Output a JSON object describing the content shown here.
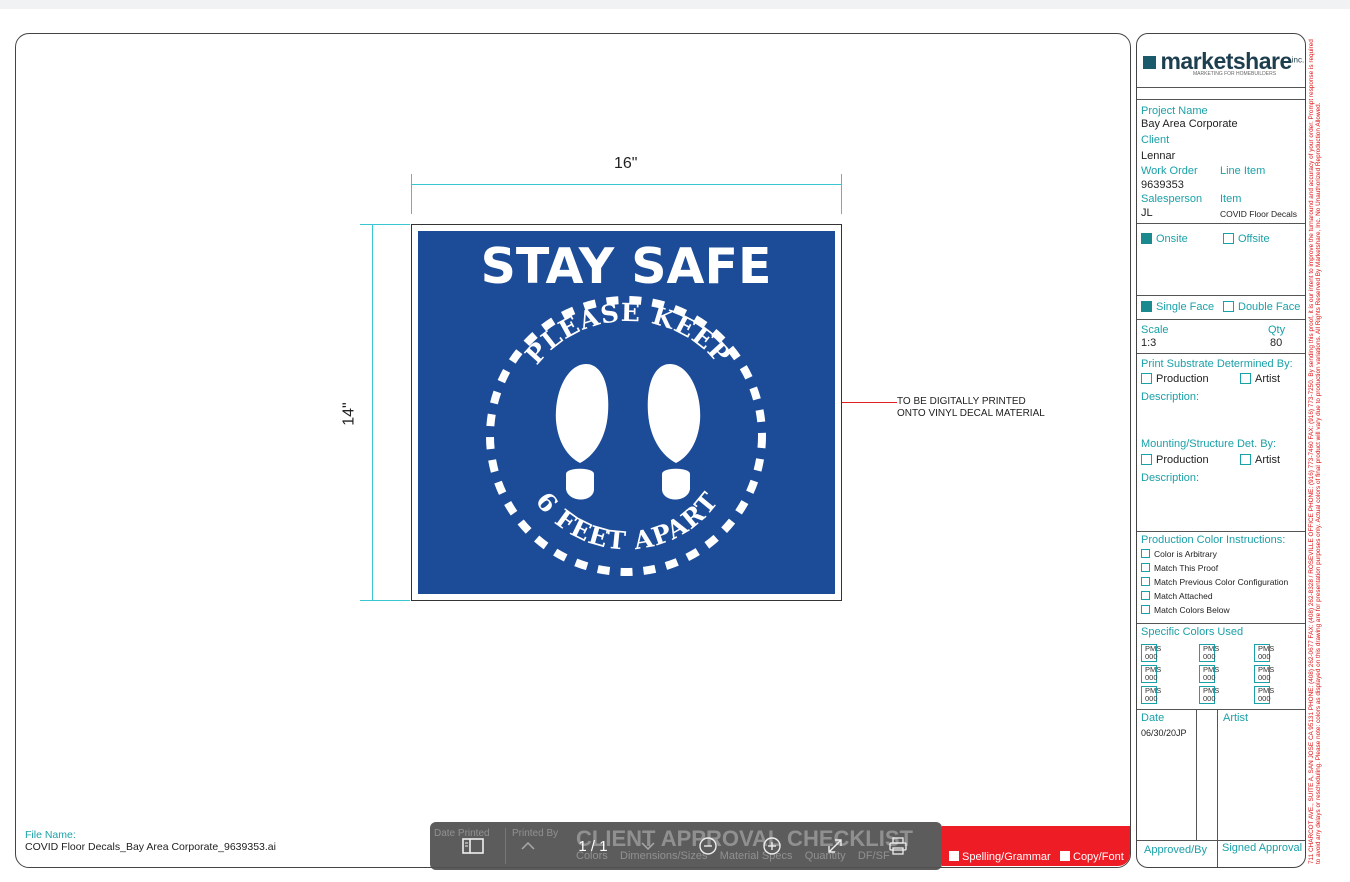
{
  "document": {
    "dimension_width": "16\"",
    "dimension_height": "14\"",
    "sign": {
      "headline": "STAY SAFE",
      "arc_top": "PLEASE KEEP",
      "arc_bottom": "6 FEET APART",
      "background_color": "#1c4b98"
    },
    "note_line1": "TO BE DIGITALLY PRINTED",
    "note_line2": "ONTO VINYL DECAL MATERIAL",
    "file_name_label": "File Name:",
    "file_name": "COVID Floor Decals_Bay Area Corporate_9639353.ai"
  },
  "title_block": {
    "logo_main": "marketshare",
    "logo_inc": "inc.",
    "logo_tagline": "MARKETING FOR HOMEBUILDERS",
    "project_name_label": "Project Name",
    "project_name": "Bay Area Corporate",
    "client_label": "Client",
    "client": "Lennar",
    "work_order_label": "Work Order",
    "work_order": "9639353",
    "line_item_label": "Line Item",
    "salesperson_label": "Salesperson",
    "salesperson": "JL",
    "item_label": "Item",
    "item": "COVID Floor Decals",
    "onsite_label": "Onsite",
    "offsite_label": "Offsite",
    "single_face_label": "Single Face",
    "double_face_label": "Double Face",
    "scale_label": "Scale",
    "scale": "1:3",
    "qty_label": "Qty",
    "qty": "80",
    "print_substrate_label": "Print Substrate Determined By:",
    "production_label": "Production",
    "artist_label": "Artist",
    "description_label": "Description:",
    "mounting_label": "Mounting/Structure Det. By:",
    "color_instructions_label": "Production Color Instructions:",
    "color_options": [
      "Color is Arbitrary",
      "Match This Proof",
      "Match Previous Color Configuration",
      "Match Attached",
      "Match Colors Below"
    ],
    "specific_colors_label": "Specific Colors Used",
    "pms_label": "PMS",
    "pms_value": "000",
    "date_label": "Date",
    "date": "06/30/20JP",
    "artist_col_label": "Artist",
    "approved_by_label": "Approved/By",
    "signed_approval_label": "Signed Approval"
  },
  "sidebar_text": "711 CHARCOT AVE., SUITE A, SAN JOSE CA 95131   PHONE: (408) 262-0677   FAX: (408) 262-8328  /  ROSEVILLE OFFICE  PHONE: (916) 773-7460  FAX: (916) 773-7250.  By sending this proof, it is our intent to improve the turnaround and accuracy of your order. Prompt response is required to avoid any delays or rescheduling. Please note: colors as displayed on this drawing are for presentation purposes only. Actual colors of final product will vary due to production variations. All Rights Reserved By Marketshare, Inc. No Unauthorized Reproduction Allowed.",
  "checklist": {
    "title": "CLIENT APPROVAL CHECKLIST",
    "date_printed_label": "Date Printed",
    "printed_by_label": "Printed By",
    "items": [
      "Colors",
      "Dimensions/Sizes",
      "Material Specs",
      "Quantity",
      "DF/SF"
    ],
    "items_red": [
      "Spelling/Grammar",
      "Copy/Font"
    ]
  },
  "viewer_toolbar": {
    "page_indicator": "1 / 1"
  },
  "colors": {
    "teal": "#1aa1a8",
    "dimension_cyan": "#38c7d0",
    "red_bar": "#ee1c25",
    "sign_blue": "#1c4b98"
  }
}
